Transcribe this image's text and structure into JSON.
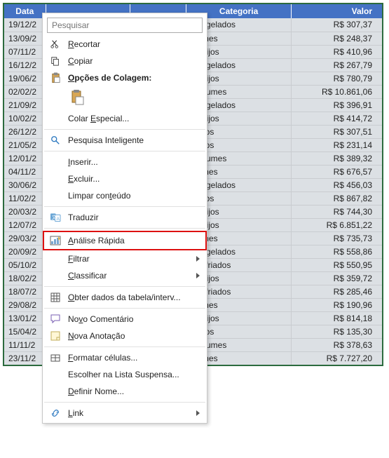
{
  "headers": {
    "date": "Data",
    "cat": "Categoria",
    "val": "Valor"
  },
  "rows": [
    {
      "date": "19/12/2",
      "cat": "Congelados",
      "val": "R$ 307,37"
    },
    {
      "date": "13/09/2",
      "cat": "Carnes",
      "val": "R$ 248,37"
    },
    {
      "date": "07/11/2",
      "cat": "Queijos",
      "val": "R$ 410,96"
    },
    {
      "date": "16/12/2",
      "cat": "Congelados",
      "val": "R$ 267,79"
    },
    {
      "date": "19/06/2",
      "cat": "Queijos",
      "val": "R$ 780,79"
    },
    {
      "date": "02/02/2",
      "cat": "Perfumes",
      "val": "R$ 10.861,06"
    },
    {
      "date": "21/09/2",
      "cat": "Congelados",
      "val": "R$ 396,91"
    },
    {
      "date": "10/02/2",
      "cat": "Queijos",
      "val": "R$ 414,72"
    },
    {
      "date": "26/12/2",
      "cat": "Sucos",
      "val": "R$ 307,51"
    },
    {
      "date": "21/05/2",
      "cat": "Sucos",
      "val": "R$ 231,14"
    },
    {
      "date": "12/01/2",
      "cat": "Perfumes",
      "val": "R$ 389,32"
    },
    {
      "date": "04/11/2",
      "cat": "Carnes",
      "val": "R$ 676,57"
    },
    {
      "date": "30/06/2",
      "cat": "Congelados",
      "val": "R$ 456,03"
    },
    {
      "date": "11/02/2",
      "cat": "Sucos",
      "val": "R$ 867,82"
    },
    {
      "date": "20/03/2",
      "cat": "Queijos",
      "val": "R$ 744,30"
    },
    {
      "date": "12/07/2",
      "cat": "Queijos",
      "val": "R$ 6.851,22"
    },
    {
      "date": "29/03/2",
      "cat": "Carnes",
      "val": "R$ 735,73"
    },
    {
      "date": "20/09/2",
      "cat": "Congelados",
      "val": "R$ 558,86"
    },
    {
      "date": "05/10/2",
      "cat": "Resfriados",
      "val": "R$ 550,95"
    },
    {
      "date": "18/02/2",
      "cat": "Queijos",
      "val": "R$ 359,72"
    },
    {
      "date": "18/07/2",
      "cat": "Resfriados",
      "val": "R$ 285,46"
    },
    {
      "date": "29/08/2",
      "cat": "Carnes",
      "val": "R$ 190,96"
    },
    {
      "date": "13/01/2",
      "cat": "Queijos",
      "val": "R$ 814,18"
    },
    {
      "date": "15/04/2",
      "cat": "Sucos",
      "val": "R$ 135,30"
    },
    {
      "date": "11/11/2",
      "cat": "Perfumes",
      "val": "R$ 378,63"
    },
    {
      "date": "23/11/2",
      "cat": "Carnes",
      "val": "R$ 7.727,20"
    }
  ],
  "menu": {
    "search_placeholder": "Pesquisar",
    "cut": "Recortar",
    "copy": "Copiar",
    "paste_header": "Opções de Colagem:",
    "paste_special": "Colar Especial...",
    "smart_lookup": "Pesquisa Inteligente",
    "insert": "Inserir...",
    "delete": "Excluir...",
    "clear": "Limpar conteúdo",
    "translate": "Traduzir",
    "quick_analysis": "Análise Rápida",
    "filter": "Filtrar",
    "sort": "Classificar",
    "get_table": "Obter dados da tabela/interv...",
    "new_comment": "Novo Comentário",
    "new_note": "Nova Anotação",
    "format_cells": "Formatar células...",
    "pick_list": "Escolher na Lista Suspensa...",
    "define_name": "Definir Nome...",
    "link": "Link"
  },
  "hotkeys": {
    "cut": "R",
    "copy": "C",
    "paste_header": "O",
    "paste_special": "E",
    "insert": "I",
    "delete": "E",
    "clear": "t",
    "quick_analysis": "A",
    "filter": "F",
    "sort": "C",
    "get_table": "O",
    "new_comment": "v",
    "new_note": "N",
    "format_cells": "F",
    "define_name": "D",
    "link": "L"
  }
}
